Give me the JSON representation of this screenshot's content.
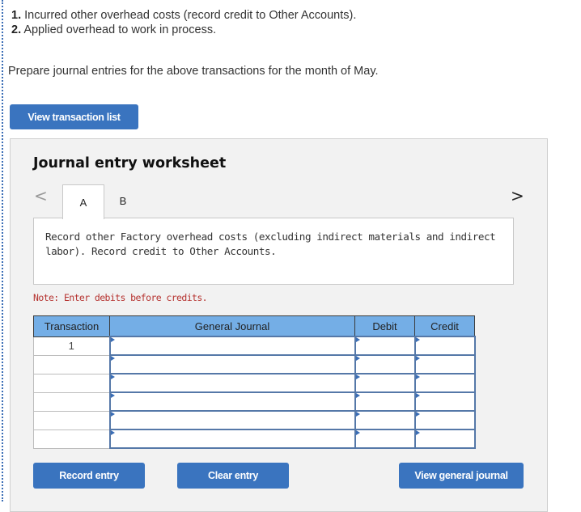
{
  "question": {
    "items": [
      {
        "number": "1.",
        "text": " Incurred other overhead costs (record credit to Other Accounts)."
      },
      {
        "number": "2.",
        "text": " Applied overhead to work in process."
      }
    ],
    "prompt": "Prepare journal entries for the above transactions for the month of May."
  },
  "buttons": {
    "view_transaction_list": "View transaction list",
    "record_entry": "Record entry",
    "clear_entry": "Clear entry",
    "view_general_journal": "View general journal"
  },
  "worksheet": {
    "title": "Journal entry worksheet",
    "nav_prev": "<",
    "nav_next": ">",
    "tabs": [
      {
        "label": "A",
        "active": true
      },
      {
        "label": "B",
        "active": false
      }
    ],
    "description": "Record other Factory overhead costs (excluding indirect materials and indirect labor). Record credit to Other Accounts.",
    "note": "Note: Enter debits before credits."
  },
  "journal_table": {
    "headers": [
      "Transaction",
      "General Journal",
      "Debit",
      "Credit"
    ],
    "rows": [
      {
        "transaction": "1",
        "account": "",
        "debit": "",
        "credit": ""
      },
      {
        "transaction": "",
        "account": "",
        "debit": "",
        "credit": ""
      },
      {
        "transaction": "",
        "account": "",
        "debit": "",
        "credit": ""
      },
      {
        "transaction": "",
        "account": "",
        "debit": "",
        "credit": ""
      },
      {
        "transaction": "",
        "account": "",
        "debit": "",
        "credit": ""
      },
      {
        "transaction": "",
        "account": "",
        "debit": "",
        "credit": ""
      }
    ]
  },
  "colors": {
    "button_blue": "#3a74bf",
    "header_blue": "#74aee6",
    "note_red": "#b5322f",
    "panel_gray": "#f2f2f2"
  }
}
